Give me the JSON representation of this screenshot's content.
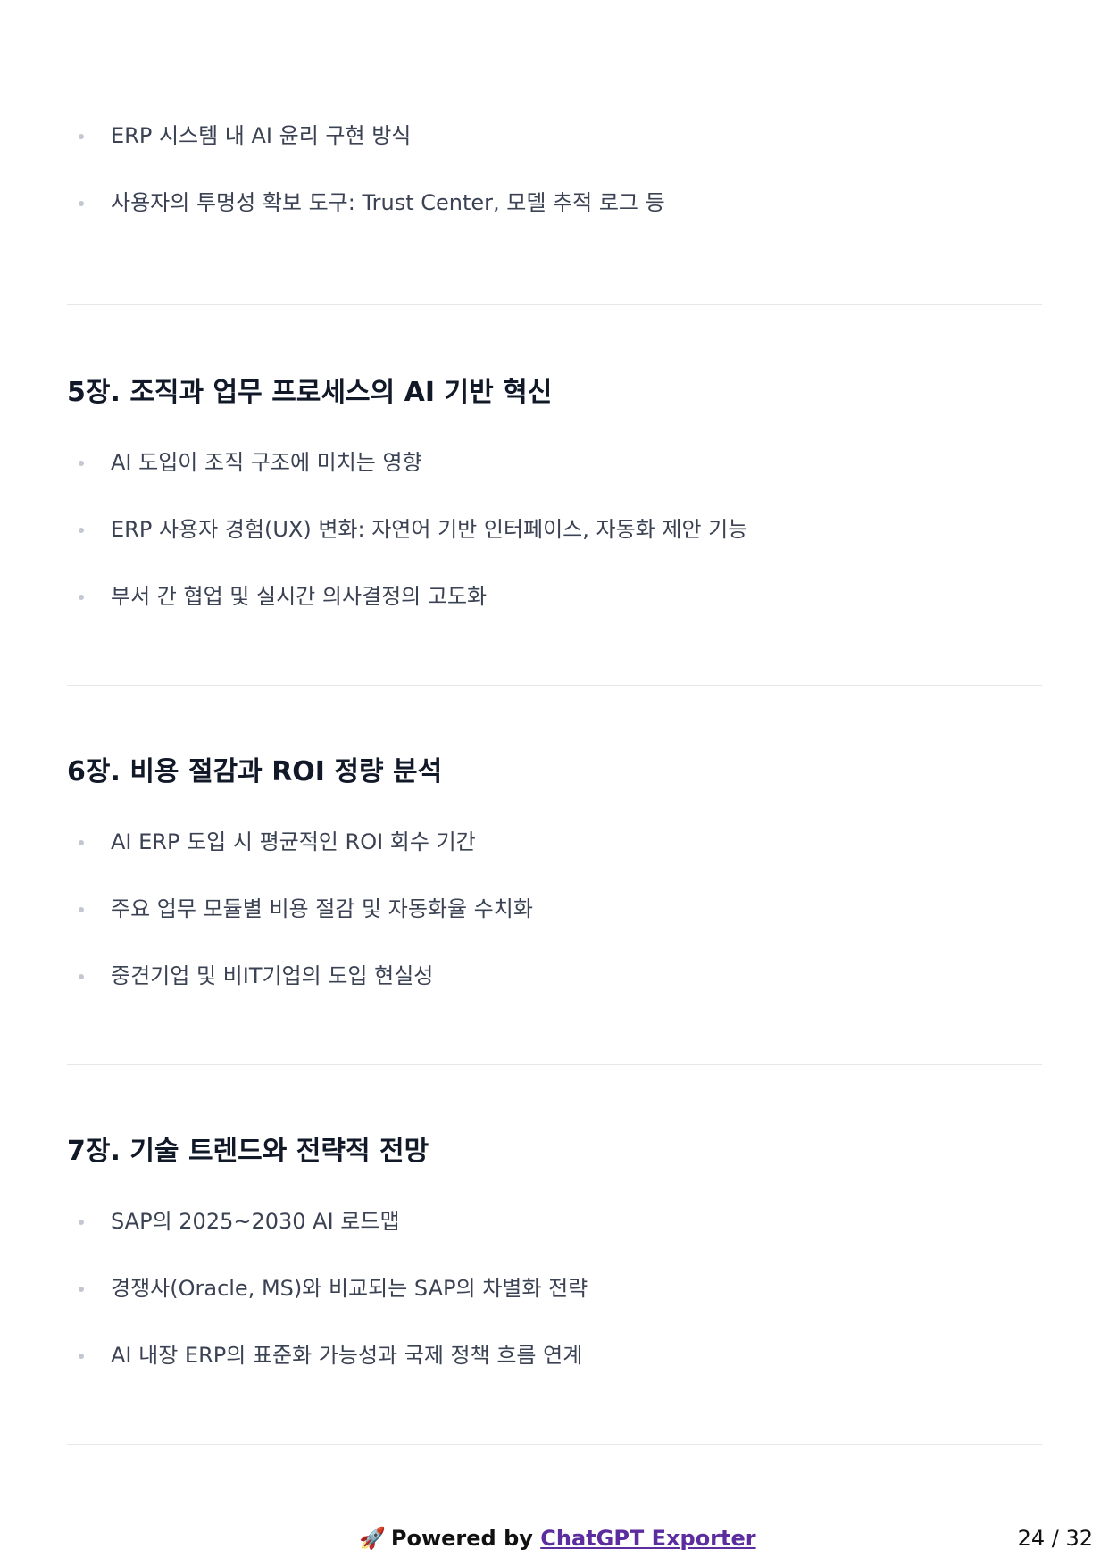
{
  "intro_bullets": [
    "ERP 시스템 내 AI 윤리 구현 방식",
    "사용자의 투명성 확보 도구: Trust Center, 모델 추적 로그 등"
  ],
  "sections": [
    {
      "title": "5장. 조직과 업무 프로세스의 AI 기반 혁신",
      "bullets": [
        "AI 도입이 조직 구조에 미치는 영향",
        "ERP 사용자 경험(UX) 변화: 자연어 기반 인터페이스, 자동화 제안 기능",
        "부서 간 협업 및 실시간 의사결정의 고도화"
      ]
    },
    {
      "title": "6장. 비용 절감과 ROI 정량 분석",
      "bullets": [
        "AI ERP 도입 시 평균적인 ROI 회수 기간",
        "주요 업무 모듈별 비용 절감 및 자동화율 수치화",
        "중견기업 및 비IT기업의 도입 현실성"
      ]
    },
    {
      "title": "7장. 기술 트렌드와 전략적 전망",
      "bullets": [
        "SAP의 2025~2030 AI 로드맵",
        "경쟁사(Oracle, MS)와 비교되는 SAP의 차별화 전략",
        "AI 내장 ERP의 표준화 가능성과 국제 정책 흐름 연계"
      ]
    }
  ],
  "footer": {
    "rocket": "🚀",
    "powered_by": "Powered by",
    "exporter_link": "ChatGPT Exporter",
    "page_number": "24 / 32"
  }
}
